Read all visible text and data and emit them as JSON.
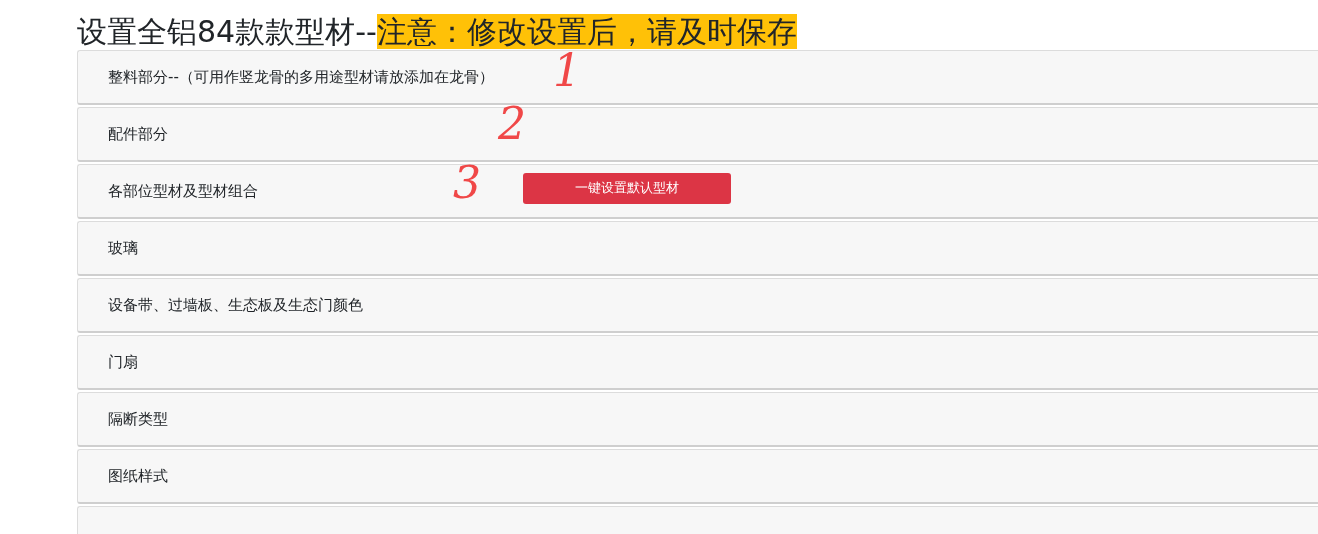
{
  "title": "设置全铝84款款型材--",
  "notice": "注意：修改设置后，请及时保存",
  "panels": [
    {
      "label": "整料部分--（可用作竖龙骨的多用途型材请放添加在龙骨）",
      "mark": "1"
    },
    {
      "label": "配件部分",
      "mark": "2"
    },
    {
      "label": "各部位型材及型材组合",
      "mark": "3",
      "button": "一键设置默认型材"
    },
    {
      "label": "玻璃"
    },
    {
      "label": "设备带、过墙板、生态板及生态门颜色"
    },
    {
      "label": "门扇"
    },
    {
      "label": "隔断类型"
    },
    {
      "label": "图纸样式"
    }
  ]
}
